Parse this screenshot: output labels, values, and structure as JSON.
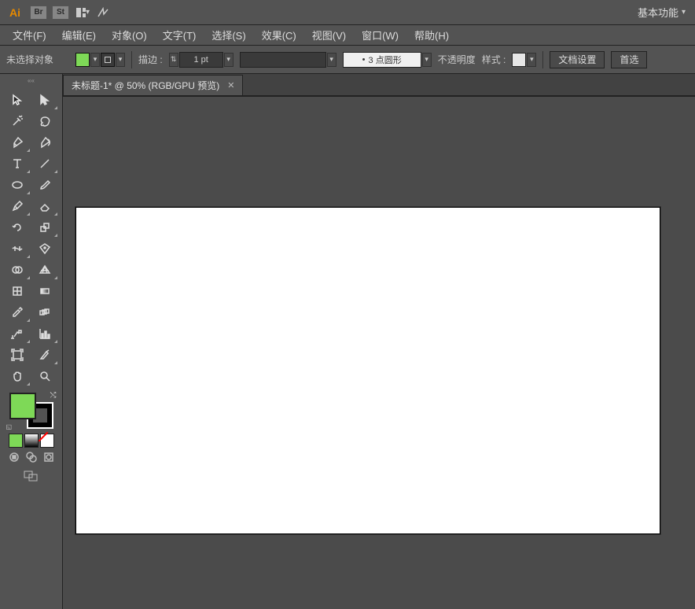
{
  "header": {
    "app_logo": "Ai",
    "btn_br": "Br",
    "btn_st": "St",
    "workspace_label": "基本功能"
  },
  "menu": {
    "file": "文件(F)",
    "edit": "编辑(E)",
    "object": "对象(O)",
    "type": "文字(T)",
    "select": "选择(S)",
    "effect": "效果(C)",
    "view": "视图(V)",
    "window": "窗口(W)",
    "help": "帮助(H)"
  },
  "control": {
    "selection_label": "未选择对象",
    "stroke_label": "描边 :",
    "stroke_value": "1 pt",
    "dash_label": "3 点圆形",
    "opacity_label": "不透明度",
    "style_label": "样式 :",
    "doc_setup_label": "文档设置",
    "prefs_label": "首选"
  },
  "document": {
    "tab_title": "未标题-1* @ 50% (RGB/GPU 预览)"
  },
  "colors": {
    "fill": "#7ed957",
    "stroke": "#000000"
  },
  "tools": {
    "rows": [
      [
        "selection",
        "direct-selection"
      ],
      [
        "magic-wand",
        "lasso"
      ],
      [
        "pen",
        "curvature-pen"
      ],
      [
        "type",
        "line-segment"
      ],
      [
        "ellipse",
        "paintbrush"
      ],
      [
        "pencil",
        "eraser"
      ],
      [
        "rotate",
        "scale"
      ],
      [
        "width",
        "free-transform"
      ],
      [
        "shape-builder",
        "perspective-grid"
      ],
      [
        "mesh",
        "gradient"
      ],
      [
        "eyedropper",
        "blend"
      ],
      [
        "symbol-sprayer",
        "column-graph"
      ],
      [
        "artboard",
        "slice"
      ],
      [
        "hand",
        "zoom"
      ]
    ]
  }
}
